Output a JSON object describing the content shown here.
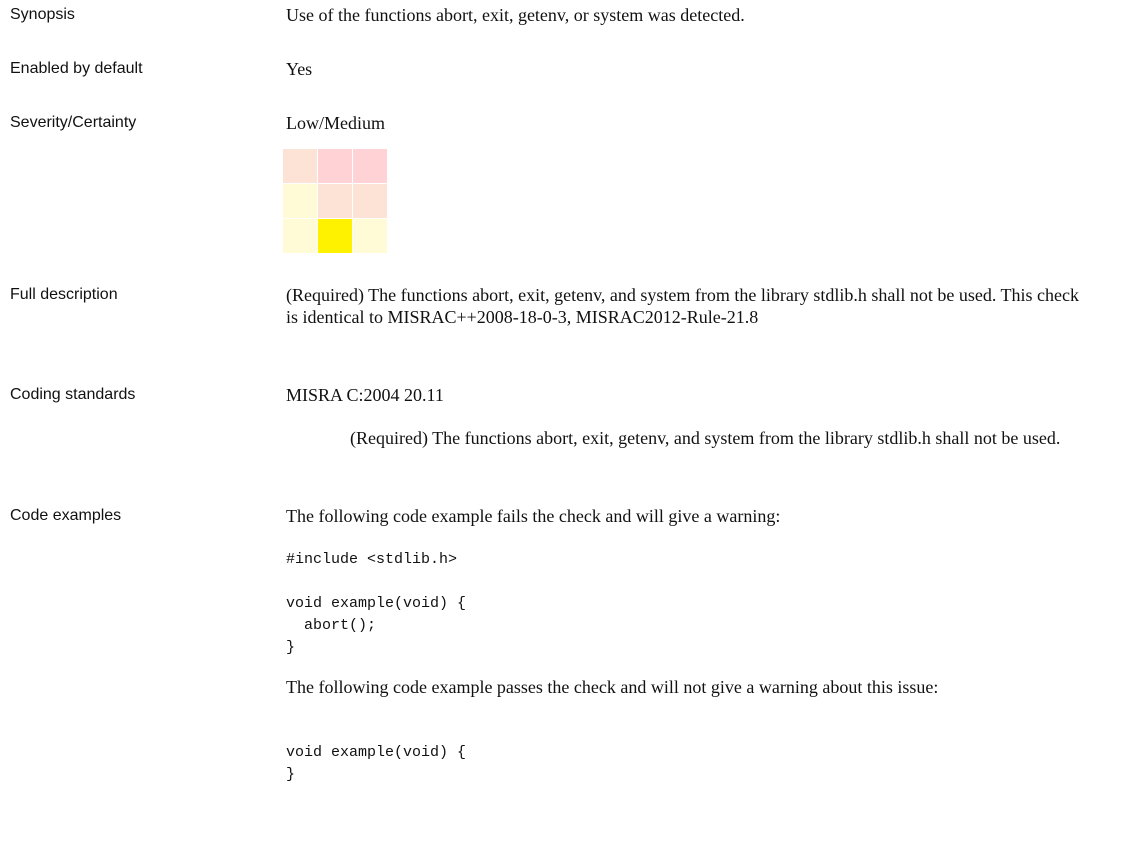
{
  "rows": {
    "synopsis": {
      "label": "Synopsis",
      "value": "Use of the functions abort, exit, getenv, or system was detected."
    },
    "enabled": {
      "label": "Enabled by default",
      "value": "Yes"
    },
    "severity": {
      "label": "Severity/Certainty",
      "value": "Low/Medium",
      "grid_colors": [
        "#fde2d6",
        "#ffd3d6",
        "#ffd3d6",
        "#fffbd6",
        "#fde2d6",
        "#fde2d6",
        "#fffbd6",
        "#fff200",
        "#fffbd6"
      ]
    },
    "full_description": {
      "label": "Full description",
      "text": "(Required) The functions abort, exit, getenv, and system from the library stdlib.h shall not be used. This check is identical to MISRAC++2008-18-0-3, MISRAC2012-Rule-21.8"
    },
    "coding_standards": {
      "label": "Coding standards",
      "standard": "MISRA C:2004 20.11",
      "standard_text": "(Required) The functions abort, exit, getenv, and system from the library stdlib.h shall not be used."
    },
    "code_examples": {
      "label": "Code examples",
      "fail_intro": "The following code example fails the check and will give a warning:",
      "fail_code_1": "#include <stdlib.h>",
      "fail_code_2": "void example(void) {\n  abort();\n}",
      "pass_intro": "The following code example passes the check and will not give a warning about this issue:",
      "pass_code": "void example(void) {\n}"
    }
  }
}
